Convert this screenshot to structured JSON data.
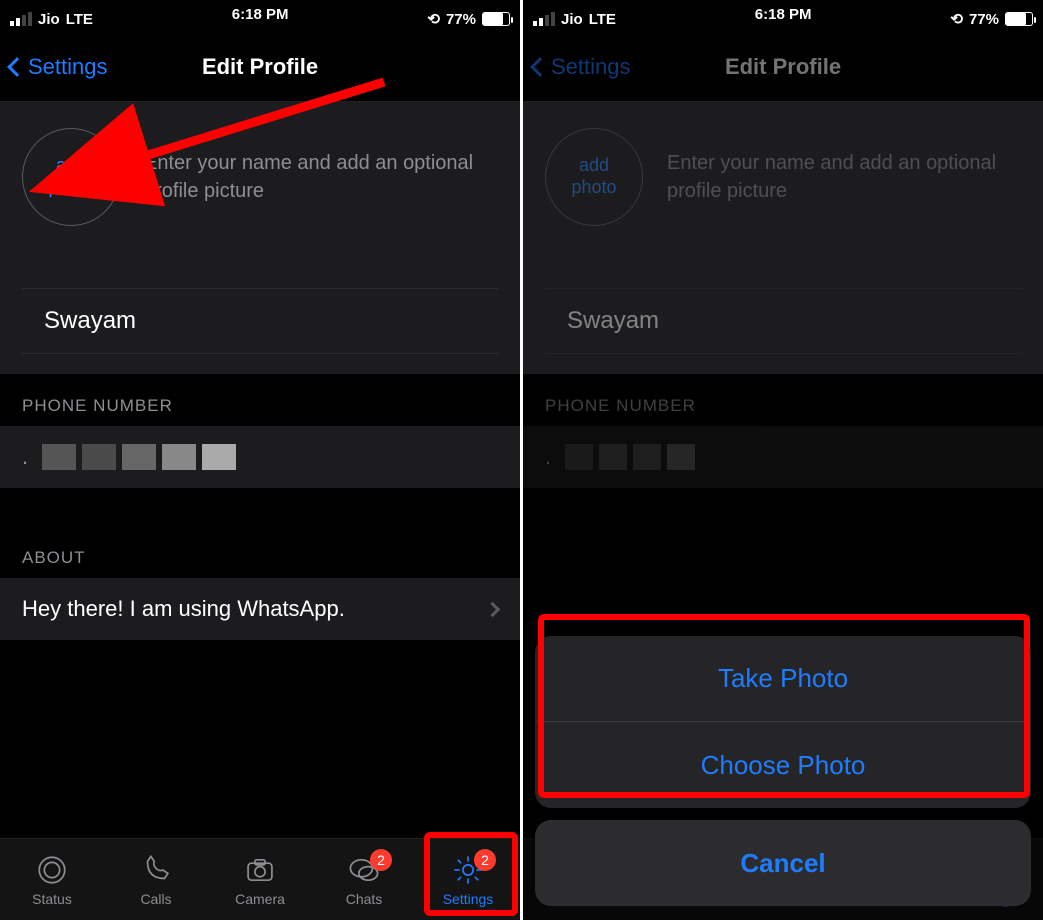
{
  "statusbar": {
    "carrier": "Jio",
    "network": "LTE",
    "time": "6:18 PM",
    "battery_pct": "77%"
  },
  "nav": {
    "back_label": "Settings",
    "title": "Edit Profile"
  },
  "profile": {
    "add_photo_label": "add\nphoto",
    "hint": "Enter your name and add an optional profile picture",
    "name": "Swayam"
  },
  "sections": {
    "phone_header": "PHONE NUMBER",
    "about_header": "ABOUT",
    "about_text": "Hey there! I am using WhatsApp."
  },
  "tabs": {
    "status": "Status",
    "calls": "Calls",
    "camera": "Camera",
    "chats": "Chats",
    "settings": "Settings",
    "chats_badge": "2",
    "settings_badge": "2"
  },
  "actionsheet": {
    "take_photo": "Take Photo",
    "choose_photo": "Choose Photo",
    "cancel": "Cancel"
  }
}
